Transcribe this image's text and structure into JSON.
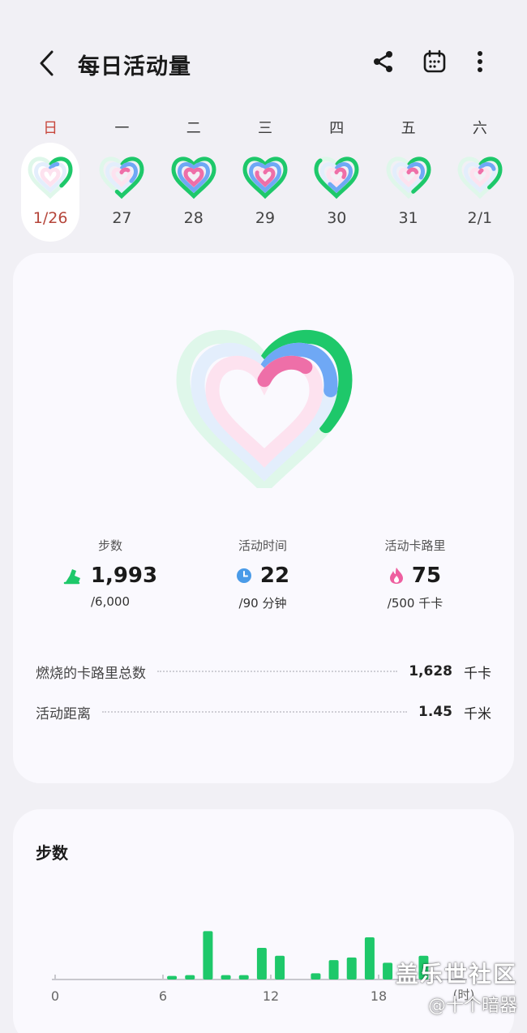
{
  "header": {
    "title": "每日活动量",
    "icons": [
      "back-arrow",
      "share-icon",
      "calendar-icon",
      "more-vertical-icon"
    ]
  },
  "week": [
    {
      "dow": "日",
      "date": "1/26",
      "selected": true,
      "rings": [
        0.38,
        0.1,
        0.0
      ]
    },
    {
      "dow": "一",
      "date": "27",
      "selected": false,
      "rings": [
        0.55,
        0.35,
        0.15
      ]
    },
    {
      "dow": "二",
      "date": "28",
      "selected": false,
      "rings": [
        1.0,
        1.0,
        1.0
      ]
    },
    {
      "dow": "三",
      "date": "29",
      "selected": false,
      "rings": [
        1.0,
        1.0,
        0.8
      ]
    },
    {
      "dow": "四",
      "date": "30",
      "selected": false,
      "rings": [
        0.85,
        0.6,
        0.3
      ]
    },
    {
      "dow": "五",
      "date": "31",
      "selected": false,
      "rings": [
        0.45,
        0.3,
        0.2
      ]
    },
    {
      "dow": "六",
      "date": "2/1",
      "selected": false,
      "rings": [
        0.4,
        0.2,
        0.05
      ]
    }
  ],
  "summary": {
    "rings": {
      "steps": 0.332,
      "active_time": 0.244,
      "calories": 0.15
    },
    "steps": {
      "label": "步数",
      "value": "1,993",
      "goal": "/6,000",
      "icon": "shoe-icon"
    },
    "active_time": {
      "label": "活动时间",
      "value": "22",
      "goal": "/90 分钟",
      "icon": "clock-icon"
    },
    "calories": {
      "label": "活动卡路里",
      "value": "75",
      "goal": "/500 千卡",
      "icon": "flame-icon"
    },
    "total_burned": {
      "label": "燃烧的卡路里总数",
      "value": "1,628",
      "unit": "千卡"
    },
    "distance": {
      "label": "活动距离",
      "value": "1.45",
      "unit": "千米"
    }
  },
  "colors": {
    "green": "#1ec86a",
    "blue": "#6fa8f5",
    "pink": "#ee6fa8",
    "green_track": "#dff7ea",
    "blue_track": "#e3eefc",
    "pink_track": "#fde2ef"
  },
  "steps_card": {
    "title": "步数"
  },
  "chart_data": {
    "type": "bar",
    "x": [
      6,
      7,
      8,
      9,
      10,
      11,
      12,
      14,
      15,
      16,
      17,
      18,
      20
    ],
    "values": [
      4,
      5,
      55,
      5,
      5,
      36,
      27,
      7,
      22,
      25,
      48,
      19,
      27
    ],
    "ylim": [
      0,
      60
    ],
    "x_ticks": [
      "0",
      "6",
      "12",
      "18"
    ],
    "x_range": [
      0,
      24
    ],
    "x_unit": "(时)",
    "color": "#1ec86a"
  },
  "watermark": {
    "line1": "盖乐世社区",
    "line2": "@十个暗器"
  }
}
